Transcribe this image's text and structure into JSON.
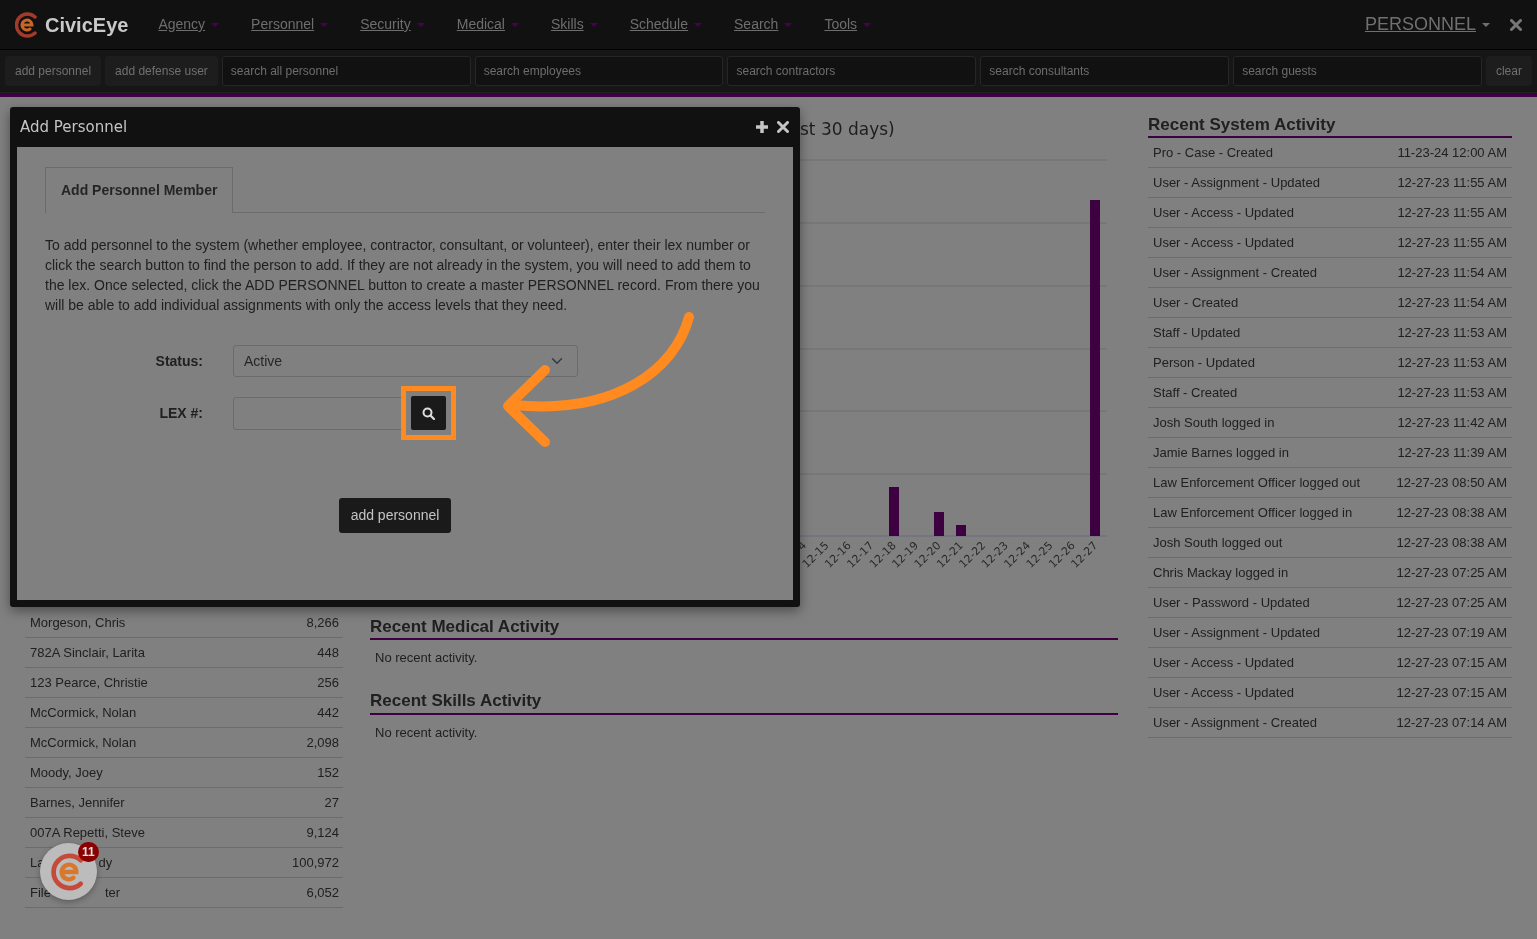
{
  "navbar": {
    "brand": "CivicEye",
    "menus": [
      "Agency",
      "Personnel",
      "Security",
      "Medical",
      "Skills",
      "Schedule",
      "Search",
      "Tools"
    ],
    "user_menu": "PERSONNEL"
  },
  "toolbar": {
    "buttons": [
      "add personnel",
      "add defense user"
    ],
    "searches": [
      {
        "placeholder": "search all personnel"
      },
      {
        "placeholder": "search employees"
      },
      {
        "placeholder": "search contractors"
      },
      {
        "placeholder": "search consultants"
      },
      {
        "placeholder": "search guests"
      }
    ],
    "clear": "clear"
  },
  "chart": {
    "title": "st 30 days)",
    "x_labels": [
      "4",
      "12-15",
      "12-16",
      "12-17",
      "12-18",
      "12-19",
      "12-20",
      "12-21",
      "12-22",
      "12-23",
      "12-24",
      "12-25",
      "12-26",
      "12-27"
    ]
  },
  "personnel_table": {
    "rows": [
      {
        "name": "Morgeson, Chris",
        "value": "8,266"
      },
      {
        "name": "782A Sinclair, Larita",
        "value": "448"
      },
      {
        "name": "123 Pearce, Christie",
        "value": "256"
      },
      {
        "name": "McCormick, Nolan",
        "value": "442"
      },
      {
        "name": "McCormick, Nolan",
        "value": "2,098"
      },
      {
        "name": "Moody, Joey",
        "value": "152"
      },
      {
        "name": "Barnes, Jennifer",
        "value": "27"
      },
      {
        "name": "007A Repetti, Steve",
        "value": "9,124"
      },
      {
        "name_parts": [
          "La",
          "dy"
        ],
        "value": "100,972"
      },
      {
        "name_parts": [
          "File",
          "ter"
        ],
        "value": "6,052"
      }
    ]
  },
  "medical": {
    "title": "Recent Medical Activity",
    "text": "No recent activity."
  },
  "skills": {
    "title": "Recent Skills Activity",
    "text": "No recent activity."
  },
  "system_activity": {
    "title": "Recent System Activity",
    "rows": [
      {
        "event": "Pro - Case - Created",
        "time": "11-23-24 12:00 AM"
      },
      {
        "event": "User - Assignment - Updated",
        "time": "12-27-23 11:55 AM"
      },
      {
        "event": "User - Access - Updated",
        "time": "12-27-23 11:55 AM"
      },
      {
        "event": "User - Access - Updated",
        "time": "12-27-23 11:55 AM"
      },
      {
        "event": "User - Assignment - Created",
        "time": "12-27-23 11:54 AM"
      },
      {
        "event": "User - Created",
        "time": "12-27-23 11:54 AM"
      },
      {
        "event": "Staff - Updated",
        "time": "12-27-23 11:53 AM"
      },
      {
        "event": "Person - Updated",
        "time": "12-27-23 11:53 AM"
      },
      {
        "event": "Staff - Created",
        "time": "12-27-23 11:53 AM"
      },
      {
        "event": "Josh South logged in",
        "time": "12-27-23 11:42 AM"
      },
      {
        "event": "Jamie Barnes logged in",
        "time": "12-27-23 11:39 AM"
      },
      {
        "event": "Law Enforcement Officer logged out",
        "time": "12-27-23 08:50 AM"
      },
      {
        "event": "Law Enforcement Officer logged in",
        "time": "12-27-23 08:38 AM"
      },
      {
        "event": "Josh South logged out",
        "time": "12-27-23 08:38 AM"
      },
      {
        "event": "Chris Mackay logged in",
        "time": "12-27-23 07:25 AM"
      },
      {
        "event": "User - Password - Updated",
        "time": "12-27-23 07:25 AM"
      },
      {
        "event": "User - Assignment - Updated",
        "time": "12-27-23 07:19 AM"
      },
      {
        "event": "User - Access - Updated",
        "time": "12-27-23 07:15 AM"
      },
      {
        "event": "User - Access - Updated",
        "time": "12-27-23 07:15 AM"
      },
      {
        "event": "User - Assignment - Created",
        "time": "12-27-23 07:14 AM"
      }
    ]
  },
  "modal": {
    "title": "Add Personnel",
    "tab": "Add Personnel Member",
    "instructions": "To add personnel to the system (whether employee, contractor, consultant, or volunteer), enter their lex number or click the search button to find the person to add. If they are not already in the system, you will need to add them to the lex. Once selected, click the ADD PERSONNEL button to create a master PERSONNEL record. From there you will be able to add individual assignments with only the access levels that they need.",
    "status_label": "Status:",
    "status_value": "Active",
    "lex_label": "LEX #:",
    "submit": "add personnel"
  },
  "chat_badge": {
    "count": "11"
  }
}
